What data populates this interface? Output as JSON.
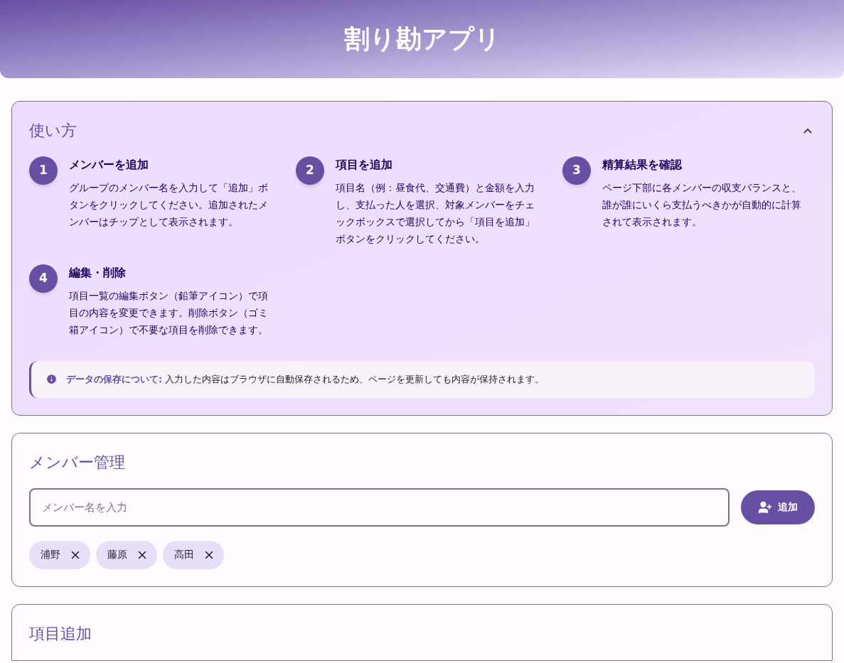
{
  "header": {
    "title": "割り勘アプリ"
  },
  "guide": {
    "title": "使い方",
    "expanded": true,
    "steps": [
      {
        "number": "1",
        "title": "メンバーを追加",
        "text": "グループのメンバー名を入力して「追加」ボタンをクリックしてください。追加されたメンバーはチップとして表示されます。"
      },
      {
        "number": "2",
        "title": "項目を追加",
        "text": "項目名（例：昼食代、交通費）と金額を入力し、支払った人を選択、対象メンバーをチェックボックスで選択してから「項目を追加」ボタンをクリックしてください。"
      },
      {
        "number": "3",
        "title": "精算結果を確認",
        "text": "ページ下部に各メンバーの収支バランスと、誰が誰にいくら支払うべきかが自動的に計算されて表示されます。"
      },
      {
        "number": "4",
        "title": "編集・削除",
        "text": "項目一覧の編集ボタン（鉛筆アイコン）で項目の内容を変更できます。削除ボタン（ゴミ箱アイコン）で不要な項目を削除できます。"
      }
    ],
    "note": {
      "label": "データの保存について:",
      "text": "入力した内容はブラウザに自動保存されるため、ページを更新しても内容が保持されます。"
    }
  },
  "members": {
    "title": "メンバー管理",
    "input": {
      "placeholder": "メンバー名を入力"
    },
    "add_button": "追加",
    "chips": [
      {
        "name": "浦野"
      },
      {
        "name": "藤原"
      },
      {
        "name": "高田"
      }
    ]
  },
  "items": {
    "title": "項目追加"
  }
}
